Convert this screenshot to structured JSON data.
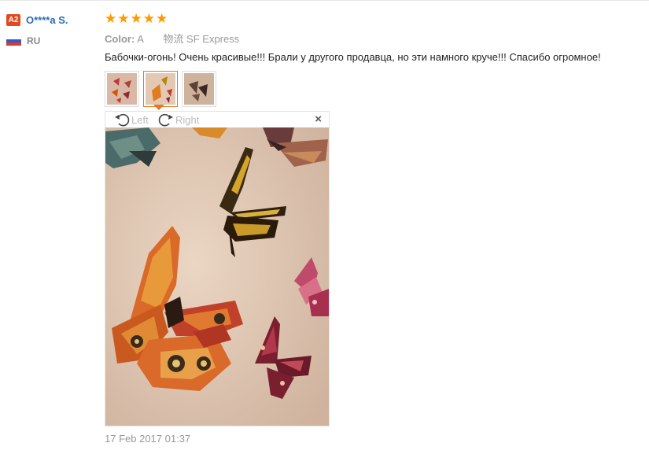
{
  "user": {
    "level_badge": "A2",
    "name": "O****a S.",
    "country": "RU"
  },
  "review": {
    "rating": 5,
    "color_label": "Color:",
    "color_value": "A",
    "shipping_label": "物流",
    "shipping_value": "SF Express",
    "text": "Бабочки-огонь! Очень красивые!!! Брали у другого продавца, но эти намного круче!!! Спасибо огромное!",
    "date": "17 Feb 2017 01:37"
  },
  "viewer": {
    "rotate_left_label": "Left",
    "rotate_right_label": "Right",
    "close_symbol": "×"
  },
  "colors": {
    "star": "#ff9900",
    "username": "#2a6bb5",
    "badge": "#e04a1f",
    "active_thumb": "#e07b1f"
  },
  "icons": [
    "star-icon",
    "russia-flag-icon",
    "rotate-left-icon",
    "rotate-right-icon",
    "close-icon"
  ]
}
